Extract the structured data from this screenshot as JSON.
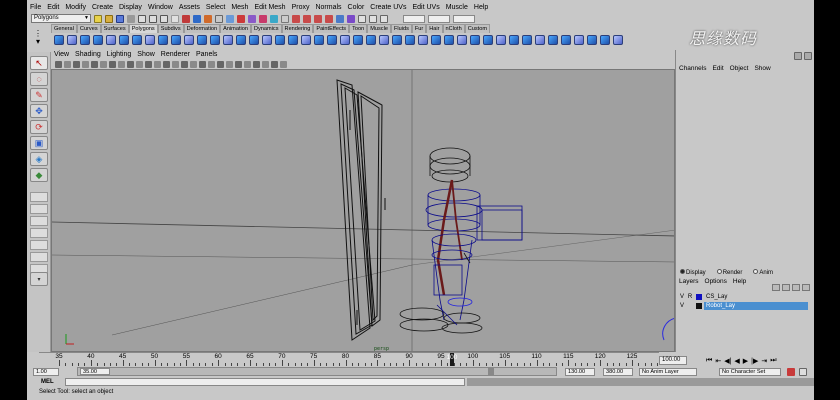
{
  "menubar": [
    "File",
    "Edit",
    "Modify",
    "Create",
    "Display",
    "Window",
    "Assets",
    "Select",
    "Mesh",
    "Edit Mesh",
    "Proxy",
    "Normals",
    "Color",
    "Create UVs",
    "Edit UVs",
    "Muscle",
    "Help"
  ],
  "statusline": {
    "mode": "Polygons"
  },
  "shelf_tabs": [
    "General",
    "Curves",
    "Surfaces",
    "Polygons",
    "Subdivs",
    "Deformation",
    "Animation",
    "Dynamics",
    "Rendering",
    "PaintEffects",
    "Toon",
    "Muscle",
    "Fluids",
    "Fur",
    "Hair",
    "nCloth",
    "Custom"
  ],
  "shelf_active": "Polygons",
  "panel_menu": [
    "View",
    "Shading",
    "Lighting",
    "Show",
    "Renderer",
    "Panels"
  ],
  "channel_box_menu": [
    "Channels",
    "Edit",
    "Object",
    "Show"
  ],
  "layer_editor": {
    "modes": [
      "Display",
      "Render",
      "Anim"
    ],
    "active_mode": "Display",
    "menu": [
      "Layers",
      "Options",
      "Help"
    ],
    "layers": [
      {
        "v": "V",
        "r": "R",
        "name": "CS_Lay",
        "color": "#1010c0",
        "selected": false
      },
      {
        "v": "V",
        "r": "",
        "name": "Robot_Lay",
        "color": "#101010",
        "selected": true
      }
    ]
  },
  "timeline": {
    "ticks": [
      "35",
      "40",
      "45",
      "50",
      "55",
      "60",
      "65",
      "70",
      "75",
      "80",
      "85",
      "90",
      "95",
      "100",
      "105",
      "110",
      "115",
      "120",
      "125"
    ],
    "current_frame": "100.00",
    "current_frame_marker": "100"
  },
  "range": {
    "start": "1.00",
    "start_inner": "35.00",
    "end_inner": "130.00",
    "end": "380.00",
    "anim_layer": "No Anim Layer",
    "character_set": "No Character Set"
  },
  "command_line": {
    "label": "MEL"
  },
  "help_line": "Select Tool: select an object",
  "viewport": {
    "origin_label": "Y",
    "axis_label": "persp"
  },
  "watermark": "思缘数码"
}
